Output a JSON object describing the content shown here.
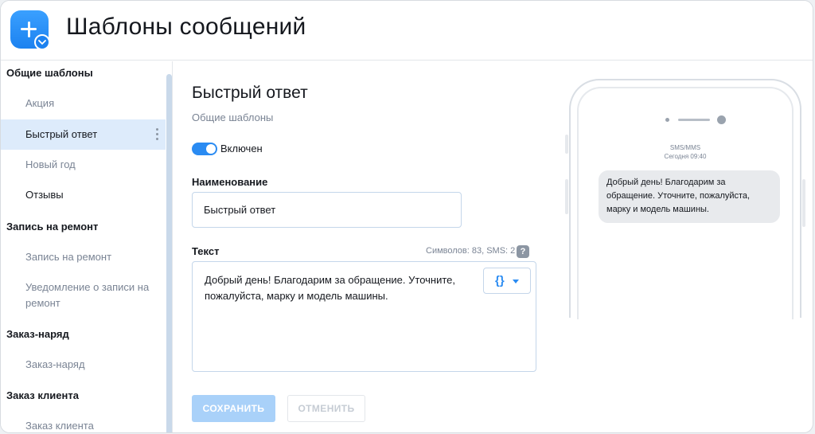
{
  "header": {
    "title": "Шаблоны сообщений",
    "app_icon": "plus-icon"
  },
  "sidebar": {
    "groups": [
      {
        "title": "Общие шаблоны",
        "items": [
          "Акция",
          "Быстрый ответ",
          "Новый год",
          "Отзывы"
        ]
      },
      {
        "title": "Запись на ремонт",
        "items": [
          "Запись на ремонт",
          "Уведомление о записи на ремонт"
        ]
      },
      {
        "title": "Заказ-наряд",
        "items": [
          "Заказ-наряд"
        ]
      },
      {
        "title": "Заказ клиента",
        "items": [
          "Заказ клиента"
        ]
      }
    ],
    "active_item": "Быстрый ответ"
  },
  "form": {
    "title": "Быстрый ответ",
    "group": "Общие шаблоны",
    "enabled": true,
    "enabled_label": "Включен",
    "name_label": "Наименование",
    "name_value": "Быстрый ответ",
    "text_label": "Текст",
    "counter": "Символов: 83, SMS: 2",
    "help": "?",
    "text_value": "Добрый день! Благодарим за обращение. Уточните, пожалуйста, марку и модель машины.",
    "variables_button": "{}",
    "save_label": "СОХРАНИТЬ",
    "cancel_label": "ОТМЕНИТЬ"
  },
  "preview": {
    "type": "SMS/MMS",
    "time": "Сегодня 09:40",
    "message": "Добрый день! Благодарим за обращение. Уточните, пожалуйста, марку и модель машины."
  },
  "colors": {
    "accent": "#2a8bf2",
    "active_item_bg": "#ddebfb",
    "save_disabled": "#a9d1f9"
  }
}
